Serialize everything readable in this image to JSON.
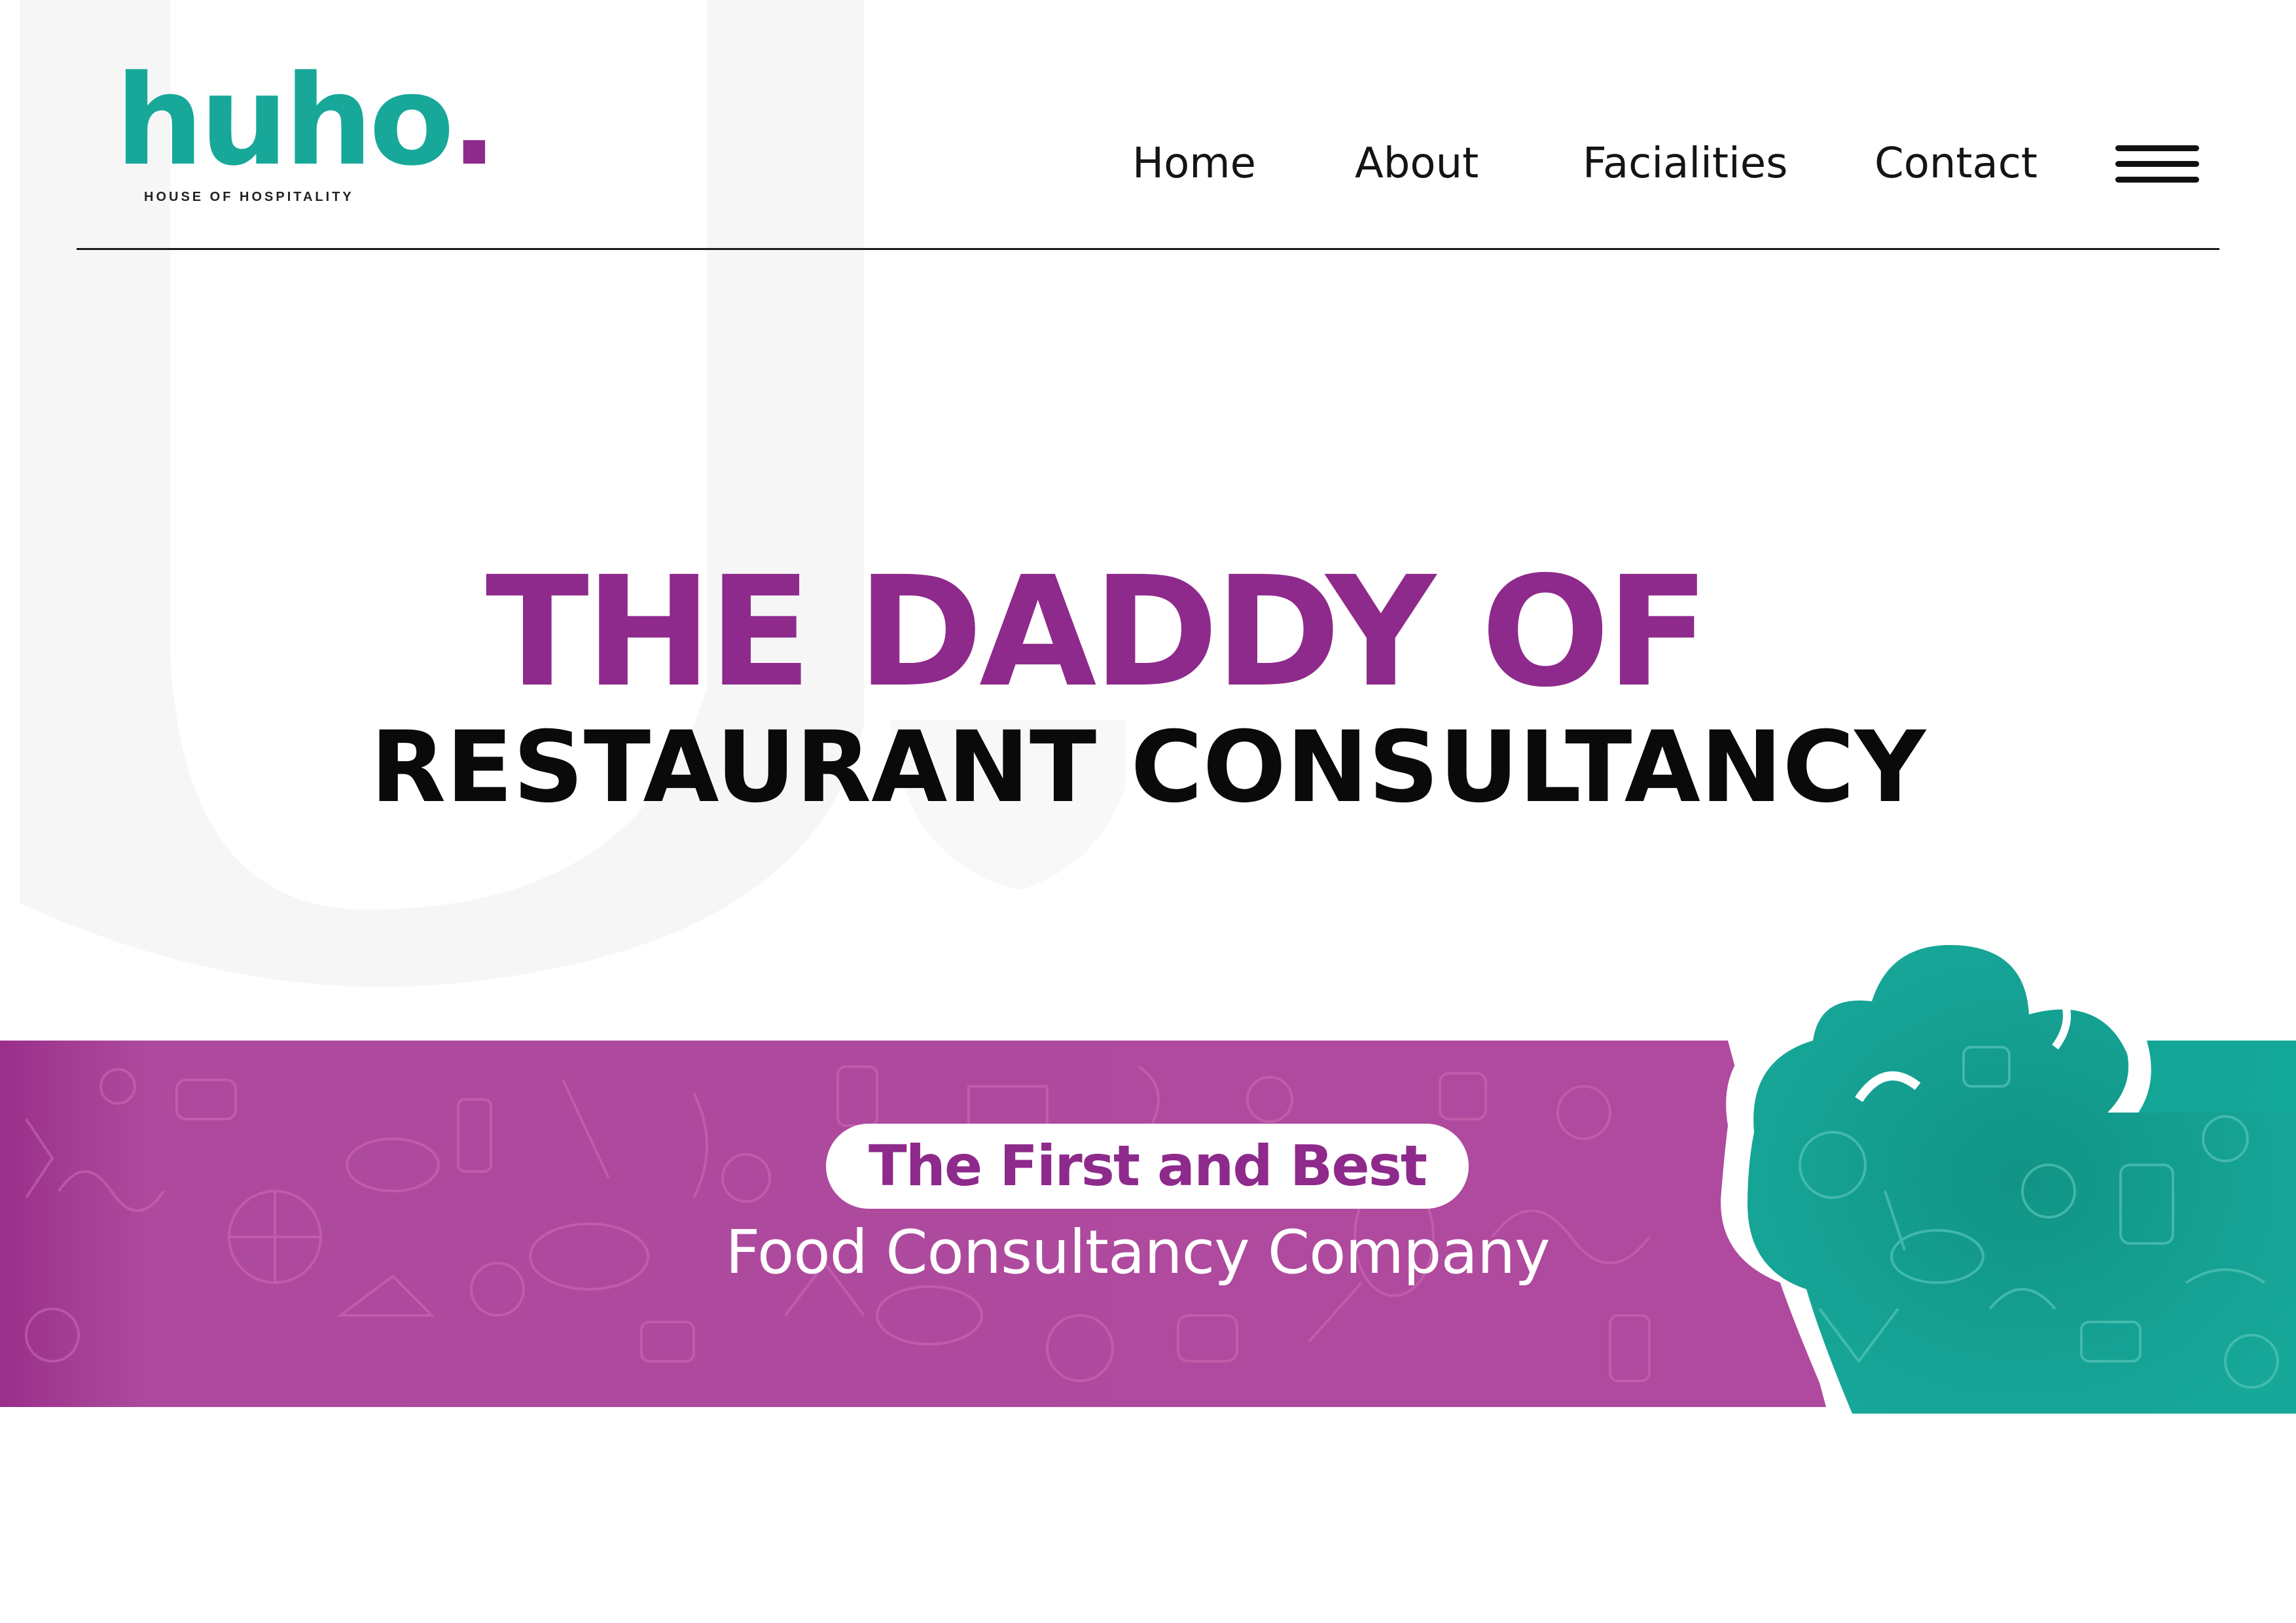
{
  "logo": {
    "wordmark": "huho",
    "dot": ".",
    "tagline": "HOUSE OF HOSPITALITY"
  },
  "nav": {
    "items": [
      {
        "label": "Home"
      },
      {
        "label": "About"
      },
      {
        "label": "Facialities"
      },
      {
        "label": "Contact"
      }
    ],
    "menu_icon": "hamburger-menu-icon"
  },
  "hero": {
    "line1": "THE DADDY OF",
    "line2": "RESTAURANT CONSULTANCY"
  },
  "banner": {
    "pill_text": "The First and Best",
    "subtitle": "Food Consultancy Company",
    "decoration": "chef-hat-illustration"
  },
  "colors": {
    "purple": "#8e2a8b",
    "magenta": "#b0479d",
    "teal": "#17a89a",
    "text": "#111111",
    "background": "#ffffff"
  }
}
